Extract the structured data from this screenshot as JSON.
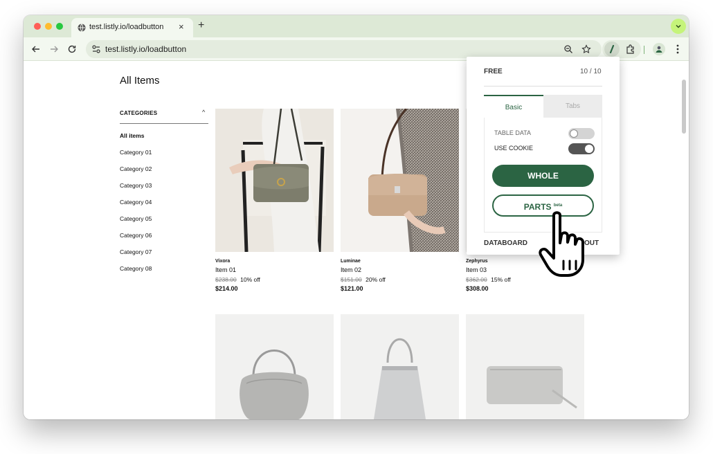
{
  "browser": {
    "tab_title": "test.listly.io/loadbutton",
    "tab_close": "×",
    "new_tab": "+",
    "url": "test.listly.io/loadbutton"
  },
  "page": {
    "title": "All Items",
    "categories_heading": "CATEGORIES",
    "categories_caret": "^",
    "categories": [
      "All items",
      "Category 01",
      "Category 02",
      "Category 03",
      "Category 04",
      "Category 05",
      "Category 06",
      "Category 07",
      "Category 08"
    ],
    "products": [
      {
        "brand": "Vixora",
        "name": "Item 01",
        "old_price": "$238.00",
        "discount": "10% off",
        "price": "$214.00"
      },
      {
        "brand": "Luminae",
        "name": "Item 02",
        "old_price": "$151.00",
        "discount": "20% off",
        "price": "$121.00"
      },
      {
        "brand": "Zephyrus",
        "name": "Item 03",
        "old_price": "$362.00",
        "discount": "15% off",
        "price": "$308.00"
      }
    ]
  },
  "popup": {
    "plan": "FREE",
    "count": "10 / 10",
    "tab_basic": "Basic",
    "tab_tabs": "Tabs",
    "option_table_data": "TABLE DATA",
    "option_use_cookie": "USE COOKIE",
    "table_data_on": false,
    "use_cookie_on": true,
    "btn_whole": "WHOLE",
    "btn_parts": "PARTS",
    "btn_parts_badge": "beta",
    "databoard": "DATABOARD",
    "logout_partial": "OUT"
  },
  "colors": {
    "accent": "#2b6443",
    "tabstrip": "#dde9d6",
    "toolbar": "#f3f8f0"
  }
}
